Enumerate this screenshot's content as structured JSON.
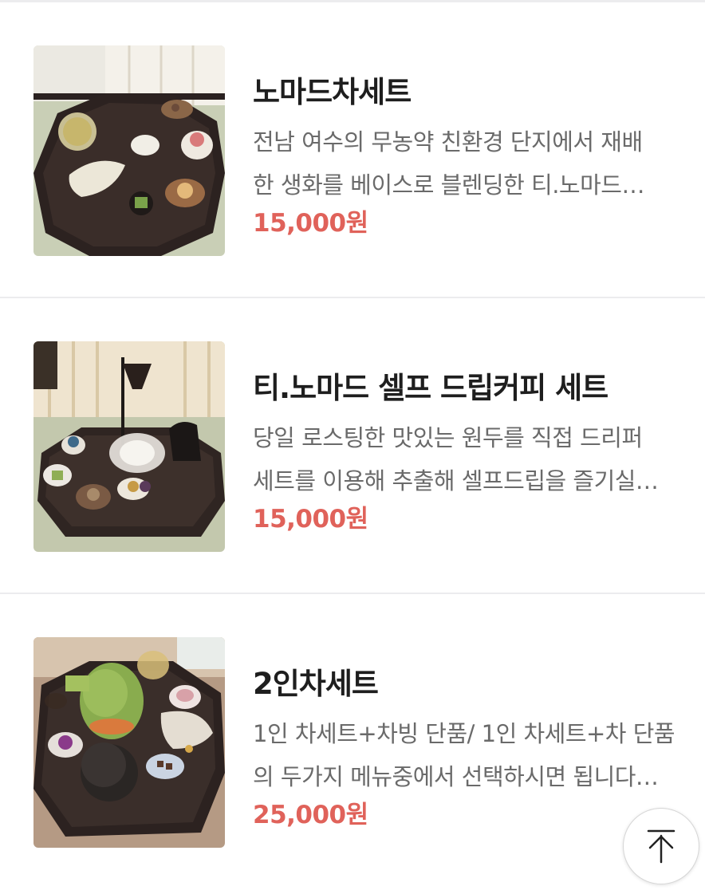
{
  "menu_items": [
    {
      "title": "노마드차세트",
      "desc_line1": "전남 여수의 무농약 친환경 단지에서 재배",
      "desc_line2": "한 생화를 베이스로 블렌딩한 티.노마드…",
      "price": "15,000원",
      "image": "tea-set-photo"
    },
    {
      "title": "티.노마드 셀프 드립커피 세트",
      "desc_line1": "당일 로스팅한 맛있는 원두를 직접 드리퍼",
      "desc_line2": "세트를 이용해 추출해 셀프드립을 즐기실…",
      "price": "15,000원",
      "image": "drip-coffee-set-photo"
    },
    {
      "title": "2인차세트",
      "desc_line1": "1인 차세트+차빙 단품/ 1인 차세트+차 단품",
      "desc_line2": "의 두가지 메뉴중에서 선택하시면 됩니다…",
      "price": "25,000원",
      "image": "two-person-tea-set-photo"
    }
  ],
  "scroll_top_icon": "arrow-up-icon",
  "colors": {
    "price": "#e0625a",
    "title": "#1e1e1e",
    "description": "#6a6a6a",
    "divider": "#ececee"
  }
}
